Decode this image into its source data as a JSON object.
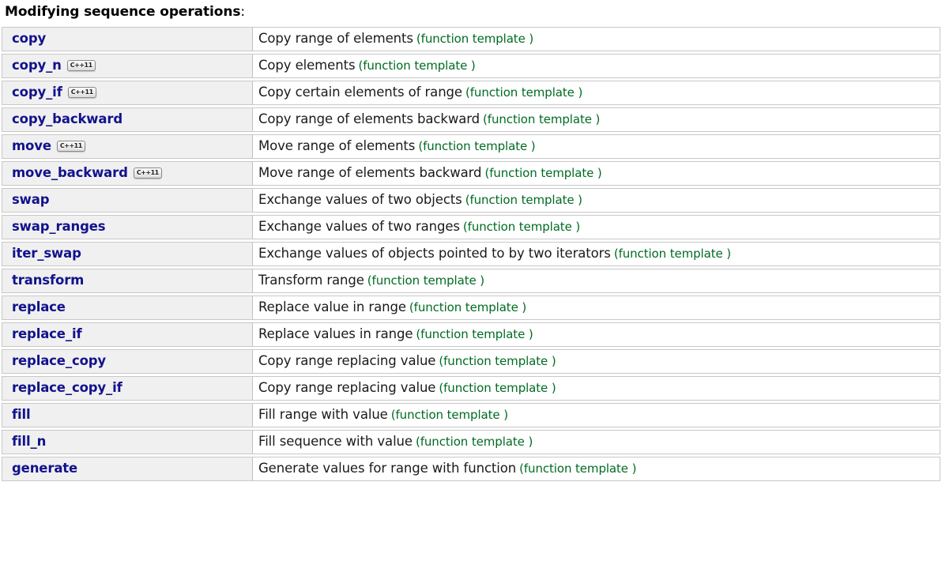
{
  "page": {
    "title_text": "Modifying sequence operations",
    "title_colon": ":",
    "accent_link_color": "#12128c",
    "kind_color": "#006b22",
    "row_name_bg": "#f0f0f0",
    "row_desc_bg": "#ffffff",
    "border_color": "#c8c8c8"
  },
  "table": {
    "badge_label": "C++11",
    "kind_label": "(function template )",
    "rows": [
      {
        "name": "copy",
        "badge": false,
        "desc": "Copy range of elements",
        "kind": "(function template )"
      },
      {
        "name": "copy_n",
        "badge": true,
        "desc": "Copy elements",
        "kind": "(function template )"
      },
      {
        "name": "copy_if",
        "badge": true,
        "desc": "Copy certain elements of range",
        "kind": "(function template )"
      },
      {
        "name": "copy_backward",
        "badge": false,
        "desc": "Copy range of elements backward",
        "kind": "(function template )"
      },
      {
        "name": "move",
        "badge": true,
        "desc": "Move range of elements",
        "kind": "(function template )"
      },
      {
        "name": "move_backward",
        "badge": true,
        "desc": "Move range of elements backward",
        "kind": "(function template )"
      },
      {
        "name": "swap",
        "badge": false,
        "desc": "Exchange values of two objects",
        "kind": "(function template )"
      },
      {
        "name": "swap_ranges",
        "badge": false,
        "desc": "Exchange values of two ranges",
        "kind": "(function template )"
      },
      {
        "name": "iter_swap",
        "badge": false,
        "desc": "Exchange values of objects pointed to by two iterators",
        "kind": "(function template )"
      },
      {
        "name": "transform",
        "badge": false,
        "desc": "Transform range",
        "kind": "(function template )"
      },
      {
        "name": "replace",
        "badge": false,
        "desc": "Replace value in range",
        "kind": "(function template )"
      },
      {
        "name": "replace_if",
        "badge": false,
        "desc": "Replace values in range",
        "kind": "(function template )"
      },
      {
        "name": "replace_copy",
        "badge": false,
        "desc": "Copy range replacing value",
        "kind": "(function template )"
      },
      {
        "name": "replace_copy_if",
        "badge": false,
        "desc": "Copy range replacing value",
        "kind": "(function template )"
      },
      {
        "name": "fill",
        "badge": false,
        "desc": "Fill range with value",
        "kind": "(function template )"
      },
      {
        "name": "fill_n",
        "badge": false,
        "desc": "Fill sequence with value",
        "kind": "(function template )"
      },
      {
        "name": "generate",
        "badge": false,
        "desc": "Generate values for range with function",
        "kind": "(function template )"
      }
    ]
  }
}
